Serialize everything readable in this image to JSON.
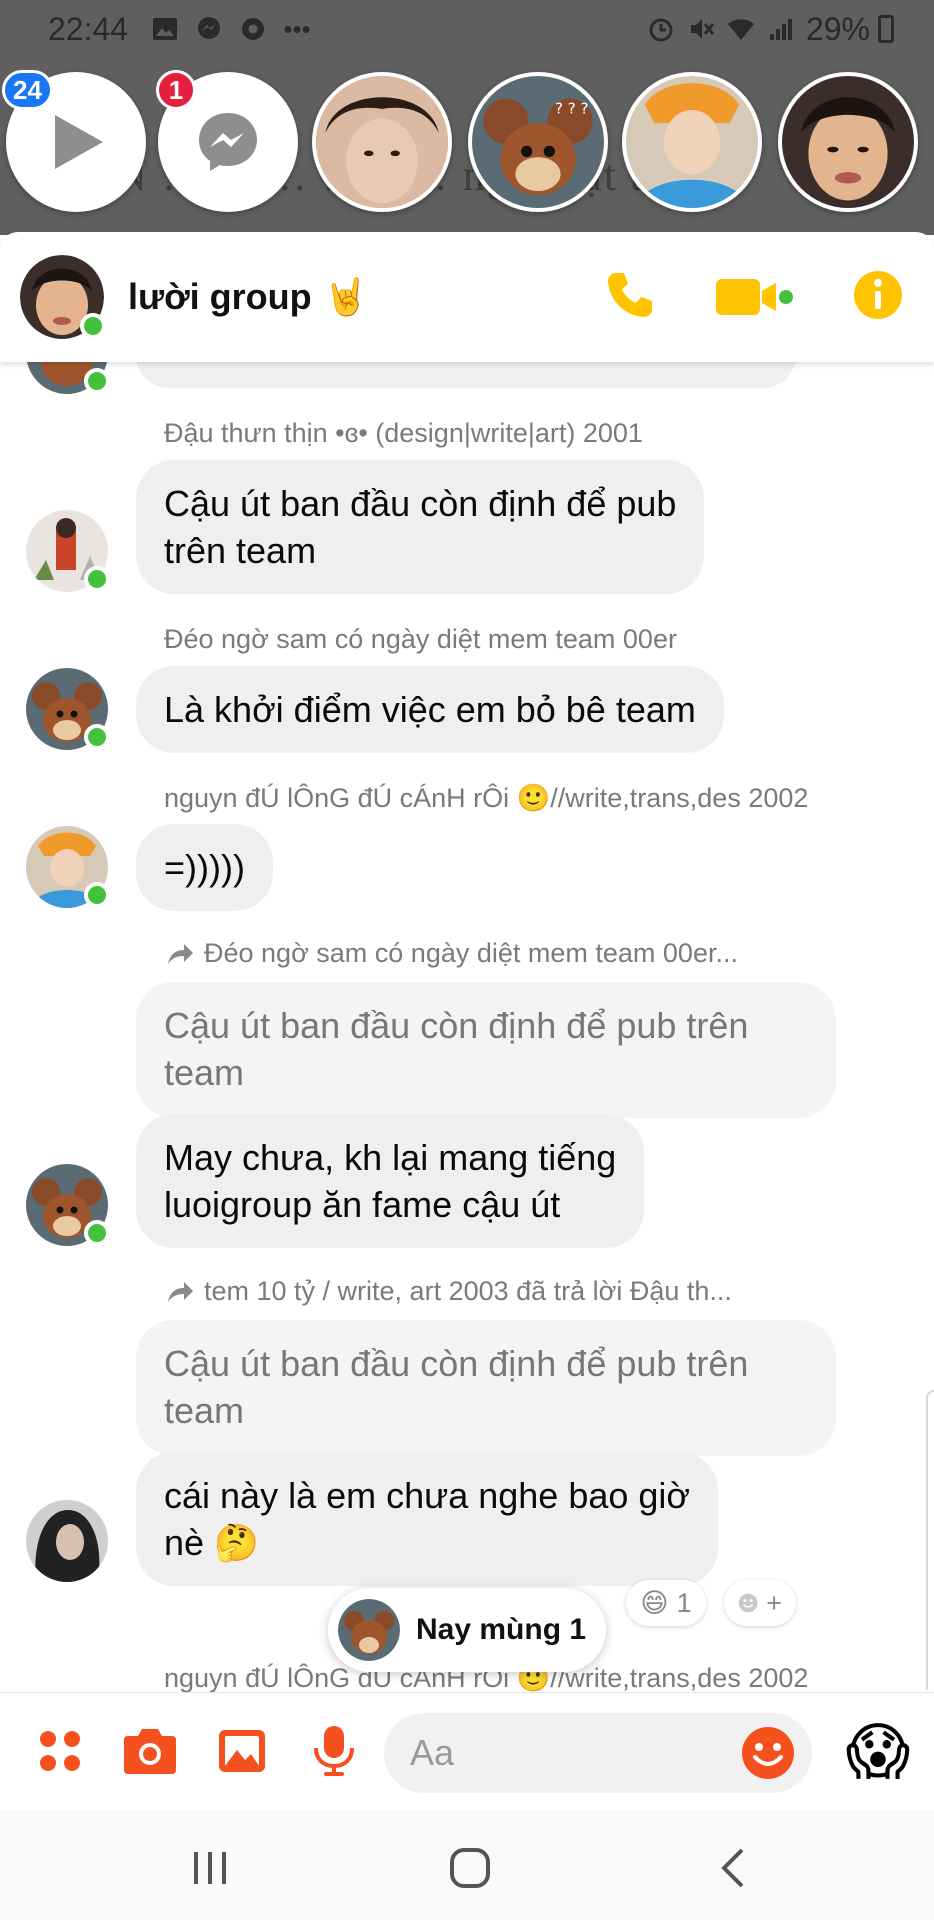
{
  "status_bar": {
    "time": "22:44",
    "battery": "29%"
  },
  "background_ghost_text": "…EN  …Ch…  …la… ng  an  ạt  a  c  n.",
  "chat_heads": [
    {
      "name": "video-player-head",
      "badge": "24",
      "badge_color": "#1877f2",
      "icon": "play-icon"
    },
    {
      "name": "messenger-head",
      "badge": "1",
      "badge_color": "#e41e3f",
      "icon": "messenger-icon"
    },
    {
      "name": "contact-head-1"
    },
    {
      "name": "contact-head-2"
    },
    {
      "name": "contact-head-3"
    },
    {
      "name": "contact-head-4"
    }
  ],
  "header": {
    "title": "lười group",
    "title_emoji": "🤘",
    "accent": "#ffc300"
  },
  "messages": [
    {
      "sender": "Đậu thưn thịn •ɞ•  (design|write|art) 2001",
      "text_lines": [
        "Cậu út ban đầu còn định để pub",
        "trên team"
      ]
    },
    {
      "sender": "Đéo ngờ sam có ngày diệt mem team 00er",
      "text_lines": [
        "Là khởi điểm việc em bỏ bê team"
      ]
    },
    {
      "sender": "nguyn đÚ lÔnG đÚ cÁnH rÔi 🙂//write,trans,des 2002",
      "text_lines": [
        "=)))))"
      ]
    },
    {
      "reply_to": "Đéo ngờ sam có ngày diệt mem team 00er...",
      "quoted_lines": [
        "Cậu út ban đầu còn định để pub trên",
        "team"
      ],
      "text_lines": [
        "May chưa, kh lại mang tiếng",
        "luoigroup ăn fame cậu út"
      ]
    },
    {
      "reply_to": "tem 10 tỷ / write, art 2003 đã trả lời Đậu th...",
      "quoted_lines": [
        "Cậu út ban đầu còn định để pub trên",
        "team"
      ],
      "text_lines": [
        "cái này là em chưa nghe bao giờ",
        "nè 🤔"
      ]
    },
    {
      "sender": "nguyn đÚ lÔnG đU cAnH rOi 🙂//write,trans,des 2002"
    }
  ],
  "reaction": {
    "emoji": "😄",
    "count": "1",
    "add_label": "+"
  },
  "toast": {
    "text": "Nay mùng 1"
  },
  "composer": {
    "placeholder": "Aa",
    "accent": "#f4511e",
    "quick_emoji": "😱"
  }
}
